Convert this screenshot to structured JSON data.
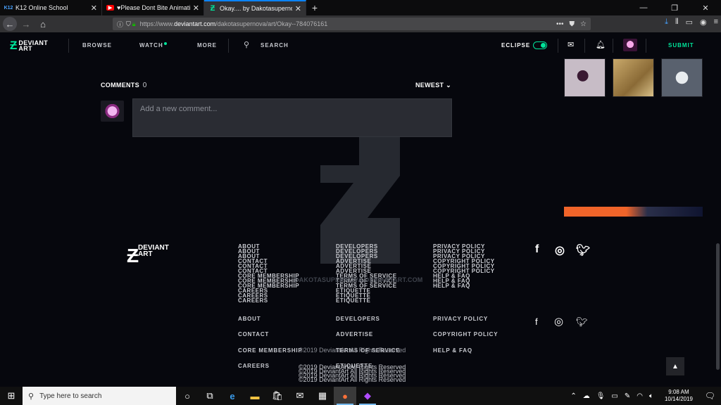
{
  "browser": {
    "tabs": [
      {
        "favicon": "K12",
        "title": "K12 Online School",
        "active": false
      },
      {
        "favicon": "youtube-icon",
        "title": "♥Please Dont Bite Animation",
        "active": false
      },
      {
        "favicon": "deviantart-icon",
        "title": "Okay.... by Dakotasupernova o",
        "active": true
      }
    ],
    "url_prefix": "https://www.",
    "url_host": "deviantart.com",
    "url_path": "/dakotasupernova/art/Okay--784076161"
  },
  "header": {
    "logo_line1": "DEVIANT",
    "logo_line2": "ART",
    "nav": [
      "BROWSE",
      "WATCH",
      "MORE"
    ],
    "search_label": "SEARCH",
    "eclipse_label": "ECLIPSE",
    "submit_label": "SUBMIT"
  },
  "comments": {
    "title": "COMMENTS",
    "count": "0",
    "sort_label": "NEWEST",
    "placeholder": "Add a new comment..."
  },
  "watermark_text": "DAKOTASUPERNOVA.DEVIANTART.COM",
  "footer": {
    "logo_line1": "DEVIANT",
    "logo_line2": "ART",
    "col1": [
      "ABOUT",
      "CONTACT",
      "CORE MEMBERSHIP",
      "CAREERS"
    ],
    "col2": [
      "DEVELOPERS",
      "ADVERTISE",
      "TERMS OF SERVICE",
      "ETIQUETTE"
    ],
    "col3": [
      "PRIVACY POLICY",
      "COPYRIGHT POLICY",
      "HELP & FAQ"
    ],
    "copyright": "©2019 DeviantArt All Rights Reserved",
    "social": [
      "facebook-icon",
      "instagram-icon",
      "twitter-icon"
    ]
  },
  "taskbar": {
    "search_placeholder": "Type here to search",
    "time": "9:08 AM",
    "date": "10/14/2019"
  },
  "colors": {
    "accent": "#00e59b",
    "page_bg": "#06070d",
    "browser_active_tab": "#0a84ff"
  }
}
